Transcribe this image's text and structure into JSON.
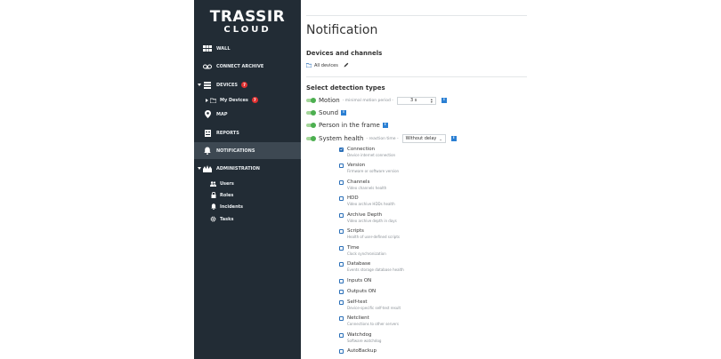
{
  "sidebar": {
    "logo_main": "TRASSIR",
    "logo_sub": "CLOUD",
    "items": [
      {
        "label": "WALL"
      },
      {
        "label": "CONNECT ARCHIVE"
      },
      {
        "label": "DEVICES",
        "badge": "7"
      },
      {
        "label": "My Devices",
        "badge": "7"
      },
      {
        "label": "MAP"
      },
      {
        "label": "REPORTS"
      },
      {
        "label": "NOTIFICATIONS"
      },
      {
        "label": "ADMINISTRATION"
      },
      {
        "label": "Users"
      },
      {
        "label": "Roles"
      },
      {
        "label": "Incidents"
      },
      {
        "label": "Tasks"
      }
    ]
  },
  "main": {
    "title": "Notification",
    "devices_section": "Devices and channels",
    "all_devices": "All devices",
    "detection_section": "Select detection types",
    "motion": {
      "label": "Motion",
      "hint": "- minimal motion period -",
      "value": "3 s"
    },
    "sound": {
      "label": "Sound"
    },
    "person": {
      "label": "Person in the frame"
    },
    "system_health": {
      "label": "System health",
      "hint": "- reaction time -",
      "select": "Without delay"
    },
    "info_icon": "i",
    "checks": [
      {
        "label": "Connection",
        "desc": "Device internet connection",
        "checked": true
      },
      {
        "label": "Version",
        "desc": "Firmware or software version",
        "checked": false
      },
      {
        "label": "Channels",
        "desc": "Video channels health",
        "checked": false
      },
      {
        "label": "HDD",
        "desc": "Video archive HDDs health",
        "checked": false
      },
      {
        "label": "Archive Depth",
        "desc": "Video archive depth in days",
        "checked": false
      },
      {
        "label": "Scripts",
        "desc": "Health of user-defined scripts",
        "checked": false
      },
      {
        "label": "Time",
        "desc": "Clock synchronization",
        "checked": false
      },
      {
        "label": "Database",
        "desc": "Events storage database health",
        "checked": false
      },
      {
        "label": "Inputs ON",
        "desc": "",
        "checked": false
      },
      {
        "label": "Outputs ON",
        "desc": "",
        "checked": false
      },
      {
        "label": "Self-test",
        "desc": "Device-specific self-test result",
        "checked": false
      },
      {
        "label": "Netclient",
        "desc": "Connections to other servers",
        "checked": false
      },
      {
        "label": "Watchdog",
        "desc": "Software watchdog",
        "checked": false
      },
      {
        "label": "AutoBackup",
        "desc": "",
        "checked": false
      }
    ]
  },
  "colors": {
    "sidebar": "#222c35",
    "active": "#3d4852",
    "accent": "#2a7fd3",
    "toggle": "#4caf50",
    "badge": "#e03030"
  }
}
